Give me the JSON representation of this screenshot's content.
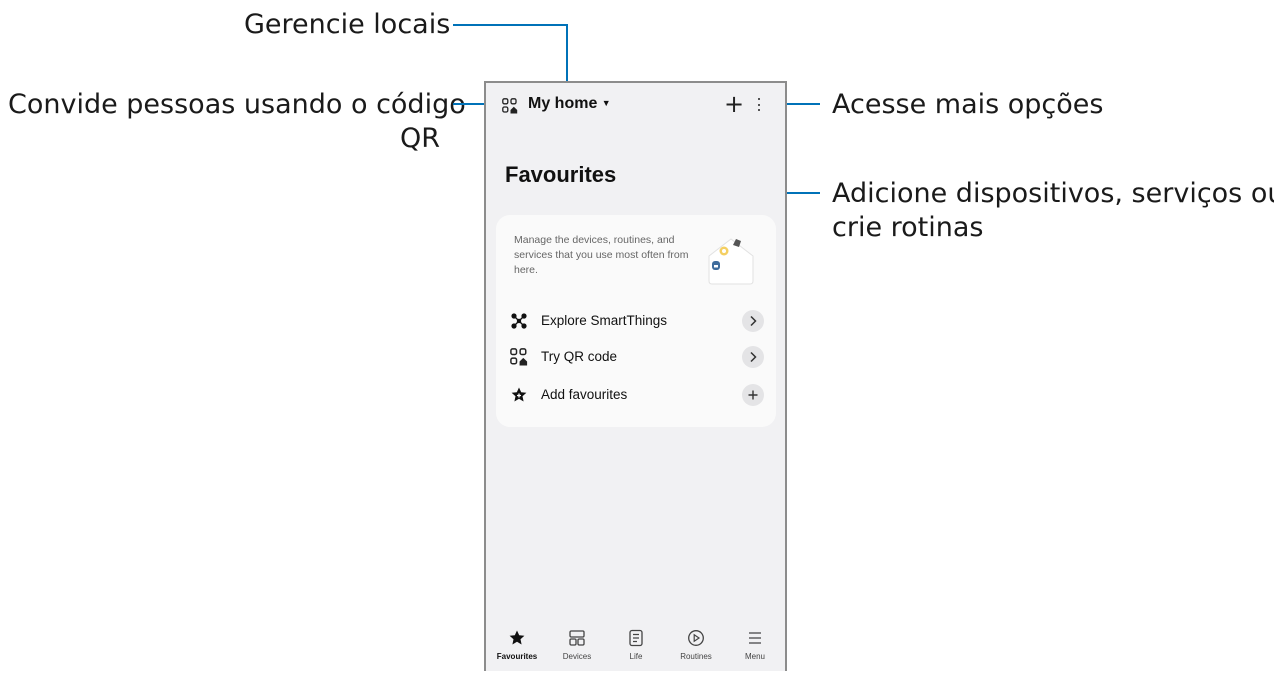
{
  "callouts": {
    "manage_locations": "Gerencie locais",
    "invite_qr_line1": "Convide pessoas usando o código",
    "invite_qr_line2": "QR",
    "more_options": "Acesse mais opções",
    "add_line1": "Adicione dispositivos, serviços ou",
    "add_line2": "crie rotinas"
  },
  "header": {
    "location": "My home",
    "dropdown_icon": "caret-down-icon",
    "add_icon": "plus-icon",
    "more_icon": "more-vertical-icon",
    "qr_icon": "qr-home-icon"
  },
  "page_title": "Favourites",
  "card": {
    "description": "Manage the devices, routines, and services that you use most often from here.",
    "illustration": "smart-home-icon",
    "items": [
      {
        "label": "Explore SmartThings",
        "icon": "smartthings-icon",
        "action_icon": "chevron-right-icon"
      },
      {
        "label": "Try QR code",
        "icon": "qr-home-icon",
        "action_icon": "chevron-right-icon"
      },
      {
        "label": "Add favourites",
        "icon": "star-add-icon",
        "action_icon": "plus-icon"
      }
    ]
  },
  "tabs": [
    {
      "label": "Favourites",
      "icon": "star-icon",
      "active": true
    },
    {
      "label": "Devices",
      "icon": "devices-icon",
      "active": false
    },
    {
      "label": "Life",
      "icon": "life-icon",
      "active": false
    },
    {
      "label": "Routines",
      "icon": "routines-icon",
      "active": false
    },
    {
      "label": "Menu",
      "icon": "menu-icon",
      "active": false
    }
  ],
  "colors": {
    "callout_line": "#0072b8",
    "screen_bg": "#f1f1f3",
    "card_bg": "#fafafa"
  }
}
